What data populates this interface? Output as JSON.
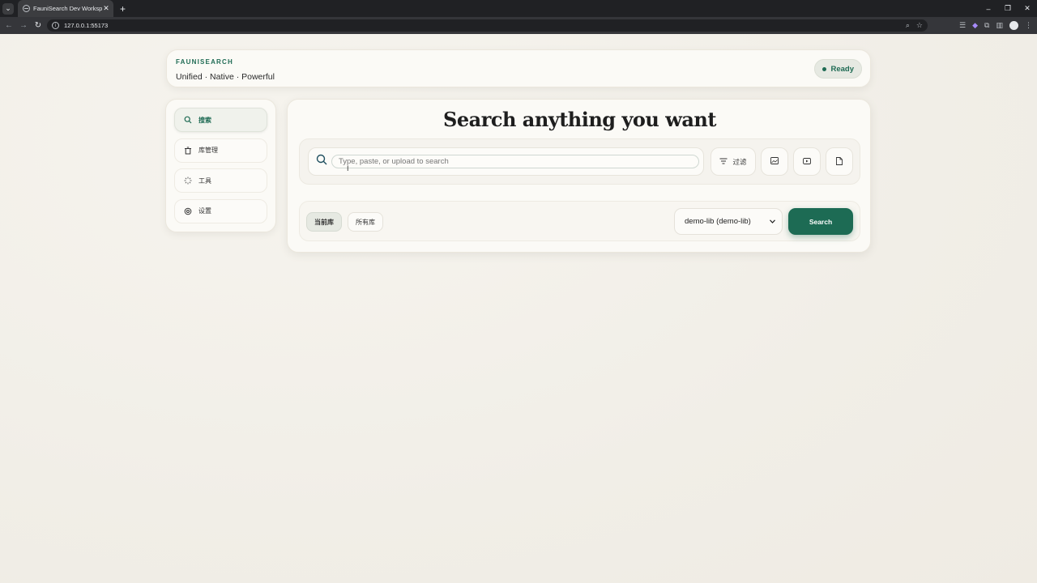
{
  "browser": {
    "tab_title": "FauniSearch Dev Workspace",
    "url": "127.0.0.1:55173",
    "window_controls": [
      "–",
      "▫",
      "✕"
    ]
  },
  "header": {
    "brand": "FAUNISEARCH",
    "tagline": "Unified · Native · Powerful",
    "status": "Ready"
  },
  "sidebar": {
    "items": [
      {
        "label": "搜索",
        "icon": "search-icon"
      },
      {
        "label": "库管理",
        "icon": "trash-icon"
      },
      {
        "label": "工具",
        "icon": "loader-icon"
      },
      {
        "label": "设置",
        "icon": "settings-icon"
      }
    ]
  },
  "main": {
    "title": "Search anything you want",
    "search_placeholder": "Type, paste, or upload to search",
    "filter_label": "过滤",
    "scope": {
      "current": "当前库",
      "all": "所有库"
    },
    "library_selected": "demo-lib (demo-lib)",
    "search_button": "Search"
  },
  "colors": {
    "accent": "#1d6b54",
    "background": "#f2efe8"
  }
}
